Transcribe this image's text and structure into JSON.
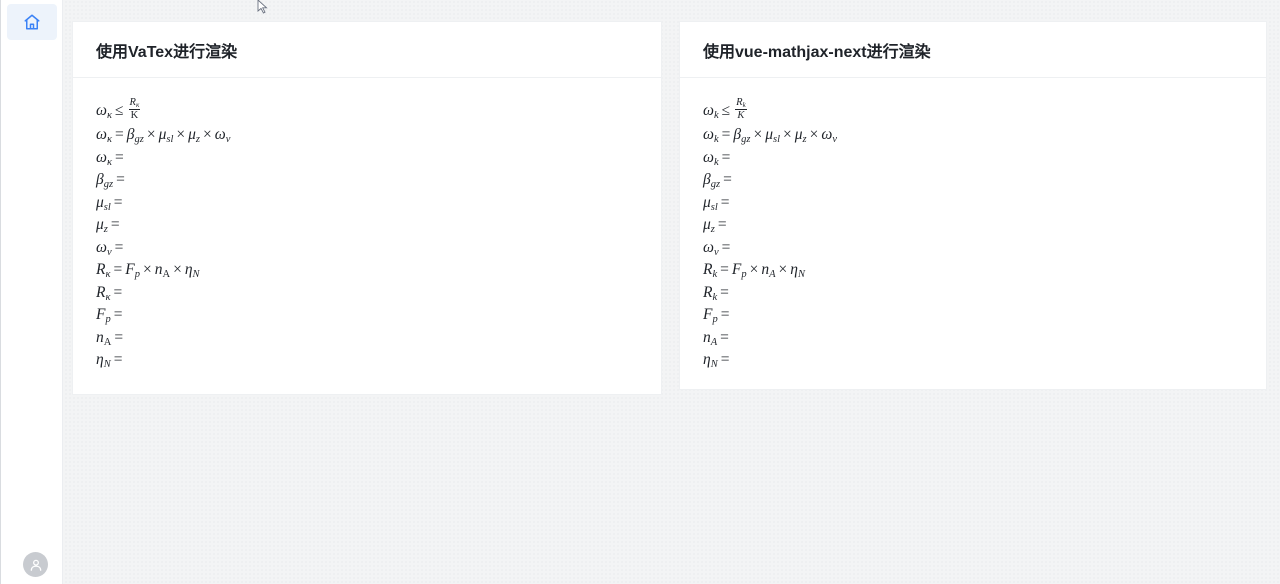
{
  "left_card": {
    "title": "使用VaTex进行渲染",
    "lines": [
      [
        "ω",
        "κ",
        " ≤ ",
        "frac:R|κ|K"
      ],
      [
        "ω",
        "κ",
        " = ",
        "β",
        "gz",
        " × ",
        "μ",
        "sl",
        " × ",
        "μ",
        "z",
        " × ",
        "ω",
        "v"
      ],
      [
        "ω",
        "κ",
        " ="
      ],
      [
        "β",
        "gz",
        " ="
      ],
      [
        "μ",
        "sl",
        " ="
      ],
      [
        "μ",
        "z",
        " ="
      ],
      [
        "ω",
        "v",
        " ="
      ],
      [
        "R",
        "κ",
        " = ",
        "F",
        "p",
        " × ",
        "n",
        "A",
        " × ",
        "η",
        "N"
      ],
      [
        "R",
        "κ",
        " ="
      ],
      [
        "F",
        "p",
        " ="
      ],
      [
        "n",
        "A",
        " ="
      ],
      [
        "η",
        "N",
        " ="
      ]
    ]
  },
  "right_card": {
    "title": "使用vue-mathjax-next进行渲染",
    "lines": [
      [
        "ω",
        "k",
        " ≤ ",
        "frac:R|k|K"
      ],
      [
        "ω",
        "k",
        " = ",
        "β",
        "gz",
        " × ",
        "μ",
        "sl",
        " × ",
        "μ",
        "z",
        " × ",
        "ω",
        "v"
      ],
      [
        "ω",
        "k",
        " ="
      ],
      [
        "β",
        "gz",
        " ="
      ],
      [
        "μ",
        "sl",
        " ="
      ],
      [
        "μ",
        "z",
        " ="
      ],
      [
        "ω",
        "v",
        " ="
      ],
      [
        "R",
        "k",
        " = ",
        "F",
        "p",
        " × ",
        "n",
        "A",
        " × ",
        "η",
        "N"
      ],
      [
        "R",
        "k",
        " ="
      ],
      [
        "F",
        "p",
        " ="
      ],
      [
        "n",
        "A",
        " ="
      ],
      [
        "η",
        "N",
        " ="
      ]
    ]
  },
  "icons": {
    "home": "home-icon",
    "avatar": "user-icon"
  },
  "colors": {
    "accent": "#3b82f6",
    "text": "#1f2329"
  }
}
